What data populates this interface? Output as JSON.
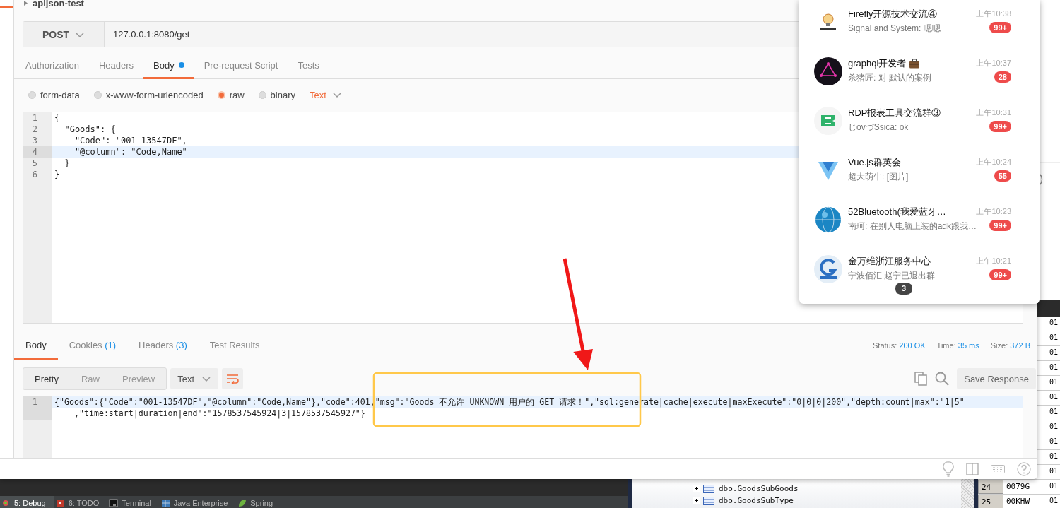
{
  "postman": {
    "collection": "apijson-test",
    "method": "POST",
    "url": "127.0.0.1:8080/get",
    "request_tabs": [
      {
        "label": "Authorization",
        "selected": false,
        "dot": false
      },
      {
        "label": "Headers",
        "selected": false,
        "dot": false
      },
      {
        "label": "Body",
        "selected": true,
        "dot": true
      },
      {
        "label": "Pre-request Script",
        "selected": false,
        "dot": false
      },
      {
        "label": "Tests",
        "selected": false,
        "dot": false
      }
    ],
    "body_modes": [
      {
        "label": "form-data",
        "selected": false
      },
      {
        "label": "x-www-form-urlencoded",
        "selected": false
      },
      {
        "label": "raw",
        "selected": true
      },
      {
        "label": "binary",
        "selected": false
      }
    ],
    "body_format": "Text",
    "request_lines": [
      {
        "number": "1",
        "text": "{",
        "current": false
      },
      {
        "number": "2",
        "text": "  \"Goods\": {",
        "current": false
      },
      {
        "number": "3",
        "text": "    \"Code\": \"001-13547DF\",",
        "current": false
      },
      {
        "number": "4",
        "text": "    \"@column\": \"Code,Name\"",
        "current": true
      },
      {
        "number": "5",
        "text": "  }",
        "current": false
      },
      {
        "number": "6",
        "text": "}",
        "current": false
      }
    ],
    "response_tabs": [
      {
        "label": "Body",
        "selected": true
      },
      {
        "label": "Cookies",
        "count": "(1)",
        "selected": false
      },
      {
        "label": "Headers",
        "count": "(3)",
        "selected": false
      },
      {
        "label": "Test Results",
        "selected": false
      }
    ],
    "response_stats": [
      {
        "label": "Status:",
        "value": "200 OK"
      },
      {
        "label": "Time:",
        "value": "35 ms"
      },
      {
        "label": "Size:",
        "value": "372 B"
      }
    ],
    "view_modes": [
      {
        "label": "Pretty",
        "selected": true
      },
      {
        "label": "Raw",
        "selected": false
      },
      {
        "label": "Preview",
        "selected": false
      }
    ],
    "response_format": "Text",
    "save_button": "Save Response",
    "response_lines": [
      {
        "number": "1",
        "current": true,
        "segments": [
          "{\"Goods\":{\"Code\":\"001-13547DF\",\"@column\":\"Code,Name\"},\"code\":401,\"msg\":\"Goods 不允许 UNKNOWN 用户的 GET 请求！\",\"sql:generate|cache|execute|maxExecute\":\"0|0|0|200\",\"depth:count|max\":\"1|5\"",
          ",\"time:start|duration|end\":\"1578537545924|3|1578537545927\"}"
        ]
      }
    ]
  },
  "chat_popup": {
    "items": [
      {
        "name": "Firefly开源技术交流④",
        "title_icon": false,
        "preview": "Signal and System: 嗯嗯",
        "time": "上午10:38",
        "badge": "99+"
      },
      {
        "name": "graphql开发者",
        "title_icon": true,
        "preview": "杀猪匠: 对 默认的案例",
        "time": "上午10:37",
        "badge": "28"
      },
      {
        "name": "RDP报表工具交流群③",
        "title_icon": false,
        "preview": "じovづSsica: ok",
        "time": "上午10:31",
        "badge": "99+"
      },
      {
        "name": "Vue.js群英会",
        "title_icon": false,
        "preview": "超大萌牛: [图片]",
        "time": "上午10:24",
        "badge": "55"
      },
      {
        "name": "52Bluetooth(我爱蓝牙…",
        "title_icon": false,
        "preview": "南珂: 在别人电脑上装的adk跟我…",
        "time": "上午10:23",
        "badge": "99+"
      },
      {
        "name": "金万维浙江服务中心",
        "title_icon": false,
        "preview": "宁波佰汇 赵宁已退出群",
        "time": "上午10:21",
        "badge": "99+"
      }
    ],
    "bubble": "3"
  },
  "ide_tool_tabs": [
    {
      "label": "5: Debug",
      "selected": true
    },
    {
      "label": "6: TODO",
      "selected": false
    },
    {
      "label": "Terminal",
      "selected": false
    },
    {
      "label": "Java Enterprise",
      "selected": false
    },
    {
      "label": "Spring",
      "selected": false
    }
  ],
  "db_tree": {
    "items": [
      "dbo.GoodsSubGoods",
      "dbo.GoodsSubType"
    ]
  },
  "data_grid": {
    "rows": [
      {
        "column_3": "01"
      },
      {
        "column_3": "01"
      },
      {
        "column_3": "01"
      },
      {
        "column_3": "01"
      },
      {
        "column_3": "01"
      },
      {
        "column_3": "01"
      },
      {
        "column_3": "01"
      },
      {
        "column_3": "01"
      },
      {
        "column_3": "01"
      },
      {
        "column_3": "01"
      },
      {
        "column_3": "01"
      },
      {
        "number": "24",
        "code": "0079G",
        "column_3": "01"
      },
      {
        "number": "25",
        "code": "00KHW",
        "column_3": "01"
      }
    ]
  },
  "annotations": [
    {
      "kind": "arrow"
    },
    {
      "kind": "frame"
    }
  ]
}
